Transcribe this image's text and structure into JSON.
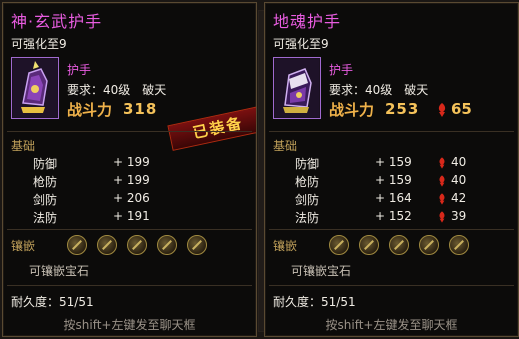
{
  "colors": {
    "accent_title": "#e85ce0",
    "power": "#f5c25a",
    "section": "#c0a05a",
    "border": "#5a4a32"
  },
  "left": {
    "title": "神·玄武护手",
    "enhance": "可强化至9",
    "item_icon": "purple-gauntlet-icon",
    "type": "护手",
    "requirement": "要求：40级　破天",
    "power_label": "战斗力",
    "power_value": "318",
    "equipped_stamp": "已装备",
    "base_label": "基础",
    "stats": [
      {
        "name": "防御",
        "value": "+ 199"
      },
      {
        "name": "枪防",
        "value": "+ 199"
      },
      {
        "name": "剑防",
        "value": "+ 206"
      },
      {
        "name": "法防",
        "value": "+ 191"
      }
    ],
    "inlay_label": "镶嵌",
    "socket_icon": "empty-socket-icon",
    "gem_text": "可镶嵌宝石",
    "durability": "耐久度：51/51",
    "hint": "按shift+左键发至聊天框"
  },
  "right": {
    "title": "地魂护手",
    "enhance": "可强化至9",
    "item_icon": "purple-gauntlet-icon",
    "type": "护手",
    "requirement": "要求：40级　破天",
    "power_label": "战斗力",
    "power_value": "253",
    "power_diff": "65",
    "diff_icon": "red-down-arrow-icon",
    "base_label": "基础",
    "stats": [
      {
        "name": "防御",
        "value": "+ 159",
        "diff": "40"
      },
      {
        "name": "枪防",
        "value": "+ 159",
        "diff": "40"
      },
      {
        "name": "剑防",
        "value": "+ 164",
        "diff": "42"
      },
      {
        "name": "法防",
        "value": "+ 152",
        "diff": "39"
      }
    ],
    "inlay_label": "镶嵌",
    "socket_icon": "empty-socket-icon",
    "gem_text": "可镶嵌宝石",
    "durability": "耐久度：51/51",
    "hint": "按shift+左键发至聊天框"
  }
}
